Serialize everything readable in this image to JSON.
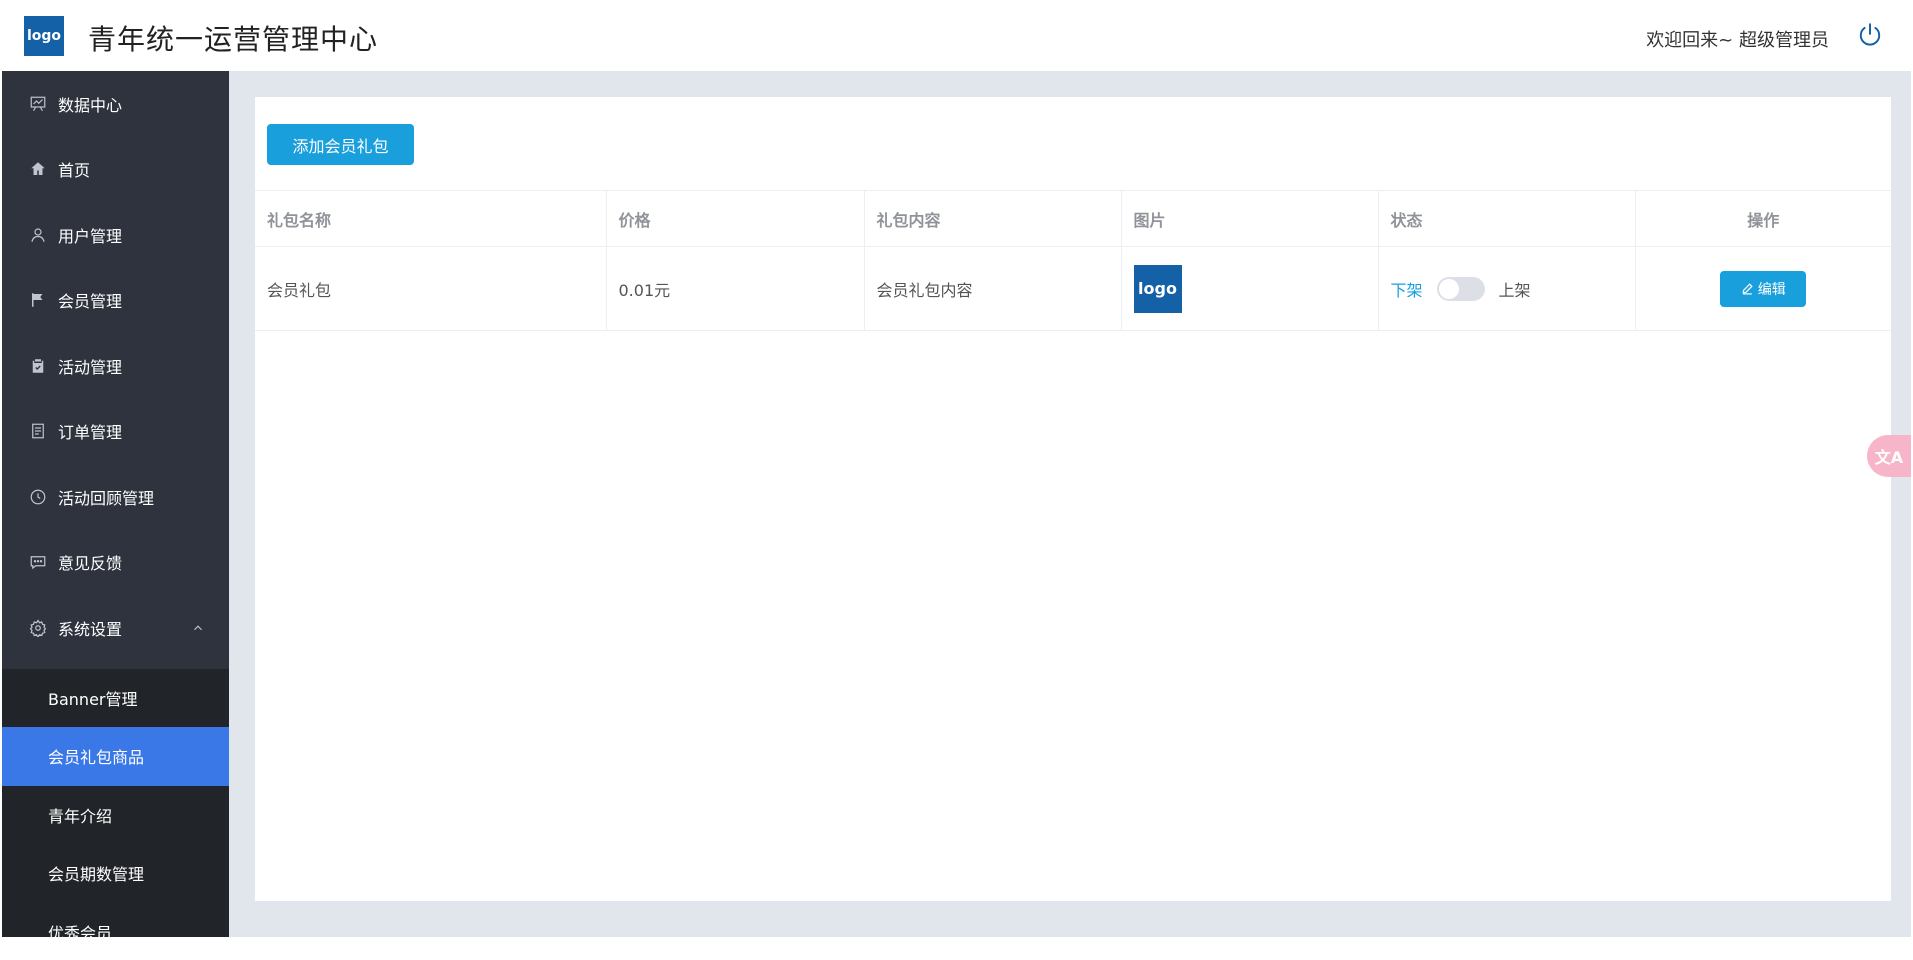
{
  "header": {
    "logo_text": "logo",
    "title": "青年统一运营管理中心",
    "welcome": "欢迎回来~ 超级管理员"
  },
  "sidebar": {
    "items": [
      {
        "label": "数据中心",
        "icon": "data-board-icon"
      },
      {
        "label": "首页",
        "icon": "home-icon"
      },
      {
        "label": "用户管理",
        "icon": "user-icon"
      },
      {
        "label": "会员管理",
        "icon": "flag-icon"
      },
      {
        "label": "活动管理",
        "icon": "clipboard-icon"
      },
      {
        "label": "订单管理",
        "icon": "document-icon"
      },
      {
        "label": "活动回顾管理",
        "icon": "clock-icon"
      },
      {
        "label": "意见反馈",
        "icon": "chat-icon"
      },
      {
        "label": "系统设置",
        "icon": "gear-icon"
      }
    ],
    "submenu": [
      {
        "label": "Banner管理"
      },
      {
        "label": "会员礼包商品",
        "active": true
      },
      {
        "label": "青年介绍"
      },
      {
        "label": "会员期数管理"
      },
      {
        "label": "优秀会员"
      }
    ]
  },
  "main": {
    "add_button": "添加会员礼包",
    "table": {
      "headers": [
        "礼包名称",
        "价格",
        "礼包内容",
        "图片",
        "状态",
        "操作"
      ],
      "rows": [
        {
          "name": "会员礼包",
          "price": "0.01元",
          "content": "会员礼包内容",
          "image_text": "logo",
          "status_off": "下架",
          "status_on": "上架",
          "enabled": false,
          "action": "编辑"
        }
      ]
    }
  },
  "floating": {
    "translate_text": "文A"
  },
  "colors": {
    "sidebar_bg": "#2e333e",
    "submenu_bg": "#212429",
    "active_bg": "#3b78e7",
    "primary": "#1a9fdd",
    "logo_bg": "#1461a8"
  }
}
